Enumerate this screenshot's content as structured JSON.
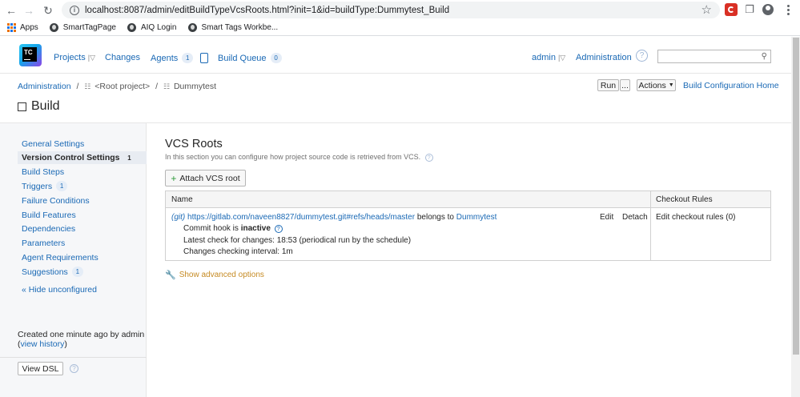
{
  "browser": {
    "url": "localhost:8087/admin/editBuildTypeVcsRoots.html?init=1&id=buildType:Dummytest_Build",
    "bookmarks": [
      "Apps",
      "SmartTagPage",
      "AIQ Login",
      "Smart Tags Workbe..."
    ]
  },
  "header": {
    "logo": "TC",
    "nav": {
      "projects": "Projects",
      "changes": "Changes",
      "agents": "Agents",
      "agents_count": "1",
      "build_queue": "Build Queue",
      "queue_count": "0"
    },
    "user": "admin",
    "administration": "Administration"
  },
  "breadcrumb": {
    "administration": "Administration",
    "separator": "/",
    "root_project": "<Root project>",
    "project": "Dummytest"
  },
  "page": {
    "title": "Build",
    "run_label": "Run",
    "run_more": "...",
    "actions_label": "Actions",
    "home_link": "Build Configuration Home"
  },
  "sidebar": {
    "items": [
      {
        "label": "General Settings",
        "count": ""
      },
      {
        "label": "Version Control Settings",
        "count": "1"
      },
      {
        "label": "Build Steps",
        "count": ""
      },
      {
        "label": "Triggers",
        "count": "1"
      },
      {
        "label": "Failure Conditions",
        "count": ""
      },
      {
        "label": "Build Features",
        "count": ""
      },
      {
        "label": "Dependencies",
        "count": ""
      },
      {
        "label": "Parameters",
        "count": ""
      },
      {
        "label": "Agent Requirements",
        "count": ""
      },
      {
        "label": "Suggestions",
        "count": "1"
      }
    ],
    "hide_unconfigured": "« Hide unconfigured",
    "created_text": "Created one minute ago by admin",
    "view_history_open": "(",
    "view_history": "view history",
    "view_history_close": ")",
    "view_dsl": "View DSL"
  },
  "main": {
    "title": "VCS Roots",
    "description": "In this section you can configure how project source code is retrieved from VCS.",
    "attach_button": "Attach VCS root",
    "table": {
      "headers": [
        "Name",
        "Checkout Rules"
      ],
      "row": {
        "prefix": "(git)",
        "url": "https://gitlab.com/naveen8827/dummytest.git#refs/heads/master",
        "belongs_to_text": "belongs to",
        "project": "Dummytest",
        "edit": "Edit",
        "detach": "Detach",
        "commit_hook_label": "Commit hook is",
        "commit_hook_status": "inactive",
        "latest_check": "Latest check for changes: 18:53 (periodical run by the schedule)",
        "interval": "Changes checking interval: 1m",
        "checkout_rules": "Edit checkout rules (0)"
      }
    },
    "advanced": "Show advanced options"
  },
  "colors": {
    "link": "#1a69b5",
    "advanced": "#c68b24",
    "sidebar_bg": "#f6f7f9"
  }
}
